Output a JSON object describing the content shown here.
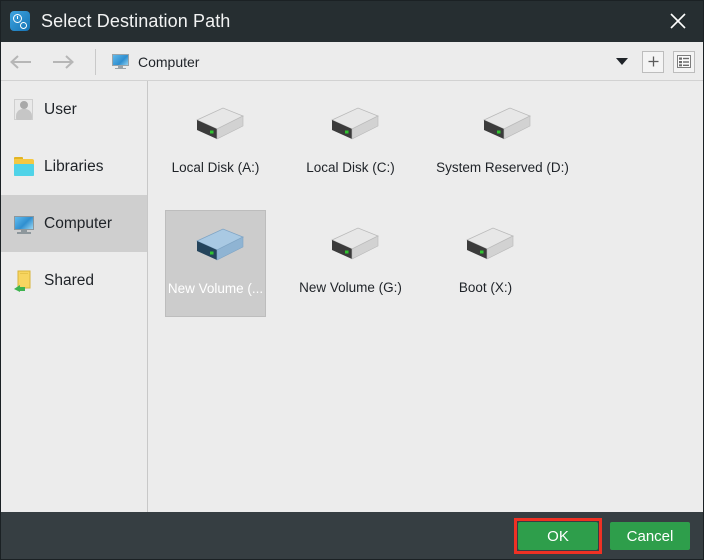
{
  "window": {
    "title": "Select Destination Path",
    "app_icon": "clock-gear-icon",
    "close_icon": "close-icon"
  },
  "toolbar": {
    "back_icon": "arrow-left-icon",
    "forward_icon": "arrow-right-icon",
    "location_icon": "computer-monitor-icon",
    "location_label": "Computer",
    "dropdown_icon": "chevron-down-icon",
    "new_folder_icon": "plus-icon",
    "view_list_icon": "list-view-icon"
  },
  "sidebar": {
    "items": [
      {
        "label": "User",
        "icon": "user-icon",
        "selected": false
      },
      {
        "label": "Libraries",
        "icon": "libraries-folder-icon",
        "selected": false
      },
      {
        "label": "Computer",
        "icon": "computer-monitor-icon",
        "selected": true
      },
      {
        "label": "Shared",
        "icon": "shared-folder-icon",
        "selected": false
      }
    ]
  },
  "content": {
    "items": [
      {
        "label": "Local Disk (A:)",
        "icon": "hard-drive-icon",
        "selected": false
      },
      {
        "label": "Local Disk (C:)",
        "icon": "hard-drive-icon",
        "selected": false
      },
      {
        "label": "System Reserved (D:)",
        "icon": "hard-drive-icon",
        "selected": false
      },
      {
        "label": "New Volume (...",
        "icon": "hard-drive-icon",
        "selected": true
      },
      {
        "label": "New Volume (G:)",
        "icon": "hard-drive-icon",
        "selected": false
      },
      {
        "label": "Boot (X:)",
        "icon": "hard-drive-icon",
        "selected": false
      }
    ]
  },
  "footer": {
    "ok_label": "OK",
    "cancel_label": "Cancel"
  },
  "colors": {
    "titlebar": "#262e31",
    "footer": "#363e42",
    "button_green": "#2e9e4b",
    "highlight_red": "#ef3124",
    "selection_gray": "#cccccc",
    "surface": "#ececec"
  }
}
